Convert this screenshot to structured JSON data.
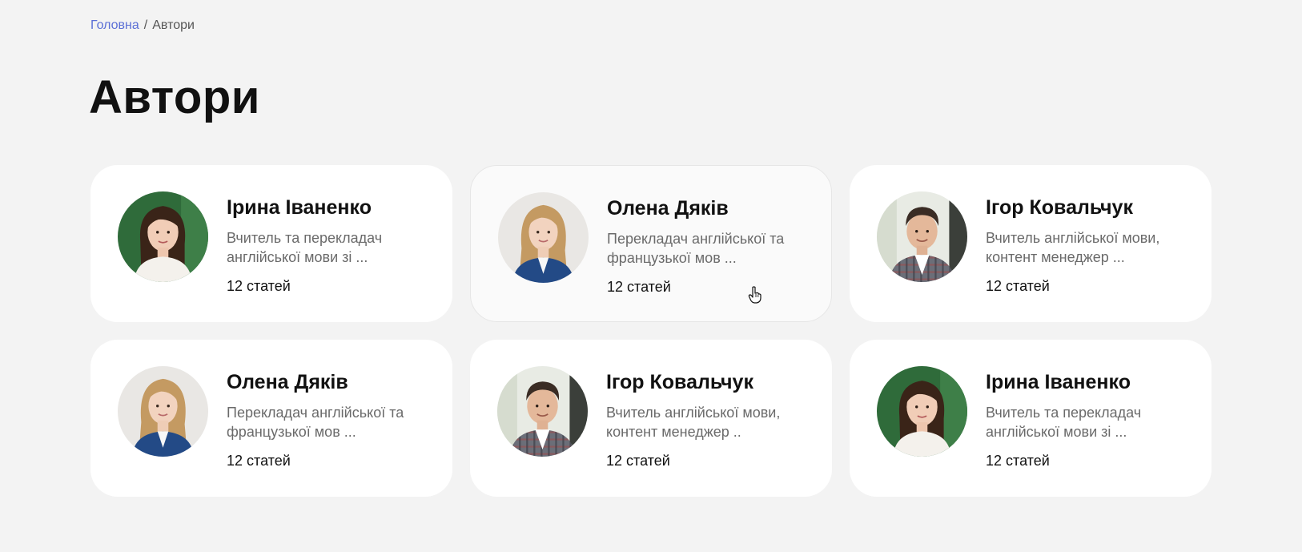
{
  "breadcrumb": {
    "home": "Головна",
    "separator": "/",
    "current": "Автори"
  },
  "page": {
    "title": "Автори"
  },
  "colors": {
    "background": "#f3f3f3",
    "card": "#ffffff",
    "link": "#5b6fd6",
    "muted_text": "#6a6a6a"
  },
  "authors": [
    {
      "name": "Ірина Іваненко",
      "desc_line1": "Вчитель та перекладач",
      "desc_line2": "англійської мови зі ...",
      "count": "12 статей",
      "avatar": "woman-dark-hair-green-bg"
    },
    {
      "name": "Олена Дяків",
      "desc_line1": "Перекладач англійської та",
      "desc_line2": "французької мов ...",
      "count": "12 статей",
      "avatar": "woman-blonde-blue-blazer"
    },
    {
      "name": "Ігор Ковальчук",
      "desc_line1": "Вчитель англійської мови,",
      "desc_line2": "контент менеджер ...",
      "count": "12 статей",
      "avatar": "man-plaid-jacket"
    },
    {
      "name": "Олена Дяків",
      "desc_line1": "Перекладач англійської та",
      "desc_line2": "французької мов ...",
      "count": "12 статей",
      "avatar": "woman-blonde-blue-blazer"
    },
    {
      "name": "Ігор Ковальчук",
      "desc_line1": "Вчитель англійської мови,",
      "desc_line2": "контент менеджер ..",
      "count": "12 статей",
      "avatar": "man-plaid-jacket"
    },
    {
      "name": "Ірина Іваненко",
      "desc_line1": "Вчитель та перекладач",
      "desc_line2": "англійської мови зі ...",
      "count": "12 статей",
      "avatar": "woman-dark-hair-green-bg"
    }
  ],
  "cursor": "hand-pointer-icon"
}
